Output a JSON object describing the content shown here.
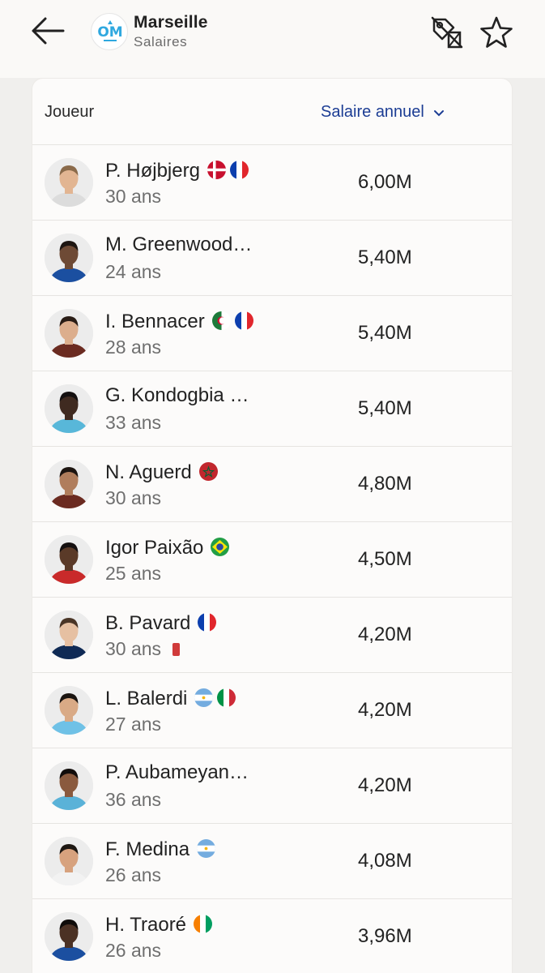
{
  "header": {
    "club_name": "Marseille",
    "subtitle": "Salaires",
    "back_icon": "arrow-left-icon",
    "compare_icon": "compare-tag-icon",
    "favorite_icon": "star-icon"
  },
  "table": {
    "col_player": "Joueur",
    "col_sort": "Salaire annuel",
    "sort_icon": "chevron-down-icon",
    "accent": "#1c3d94",
    "rows": [
      {
        "name": "P. Højbjerg",
        "age": "30 ans",
        "salary": "6,00M",
        "flags": [
          "denmark",
          "france"
        ],
        "red_card": false
      },
      {
        "name": "M. Greenwood…",
        "age": "24 ans",
        "salary": "5,40M",
        "flags": [],
        "red_card": false
      },
      {
        "name": "I. Bennacer",
        "age": "28 ans",
        "salary": "5,40M",
        "flags": [
          "algeria",
          "france"
        ],
        "red_card": false
      },
      {
        "name": "G. Kondogbia …",
        "age": "33 ans",
        "salary": "5,40M",
        "flags": [],
        "red_card": false
      },
      {
        "name": "N. Aguerd",
        "age": "30 ans",
        "salary": "4,80M",
        "flags": [
          "morocco"
        ],
        "red_card": false
      },
      {
        "name": "Igor Paixão",
        "age": "25 ans",
        "salary": "4,50M",
        "flags": [
          "brazil"
        ],
        "red_card": false
      },
      {
        "name": "B. Pavard",
        "age": "30 ans",
        "salary": "4,20M",
        "flags": [
          "france"
        ],
        "red_card": true
      },
      {
        "name": "L. Balerdi",
        "age": "27 ans",
        "salary": "4,20M",
        "flags": [
          "argentina",
          "italy"
        ],
        "red_card": false
      },
      {
        "name": "P. Aubameyan…",
        "age": "36 ans",
        "salary": "4,20M",
        "flags": [],
        "red_card": false
      },
      {
        "name": "F. Medina",
        "age": "26 ans",
        "salary": "4,08M",
        "flags": [
          "argentina"
        ],
        "red_card": false
      },
      {
        "name": "H. Traoré",
        "age": "26 ans",
        "salary": "3,96M",
        "flags": [
          "ivory-coast"
        ],
        "red_card": false
      }
    ]
  }
}
